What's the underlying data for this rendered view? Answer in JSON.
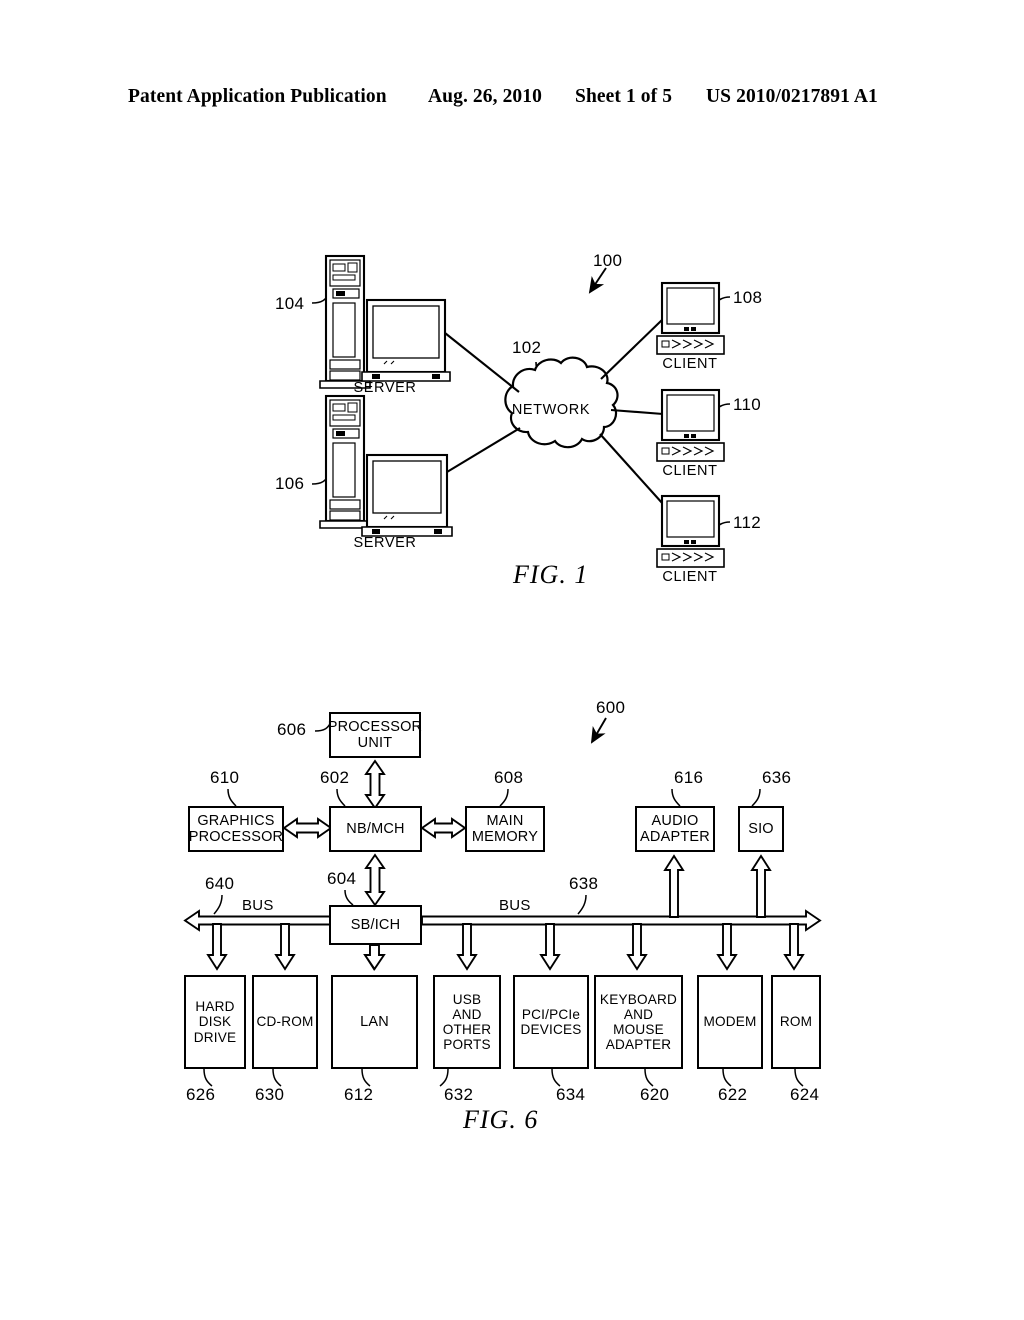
{
  "header": {
    "publication": "Patent Application Publication",
    "date": "Aug. 26, 2010",
    "sheet": "Sheet 1 of 5",
    "patent_number": "US 2010/0217891 A1"
  },
  "figure1": {
    "caption": "FIG. 1",
    "system_ref": "100",
    "network": {
      "label": "NETWORK",
      "ref": "102"
    },
    "servers": [
      {
        "label": "SERVER",
        "ref": "104"
      },
      {
        "label": "SERVER",
        "ref": "106"
      }
    ],
    "clients": [
      {
        "label": "CLIENT",
        "ref": "108"
      },
      {
        "label": "CLIENT",
        "ref": "110"
      },
      {
        "label": "CLIENT",
        "ref": "112"
      }
    ]
  },
  "figure6": {
    "caption": "FIG. 6",
    "system_ref": "600",
    "bus_label_left": "BUS",
    "bus_label_right": "BUS",
    "bus_ref_left": "640",
    "bus_ref_right": "638",
    "blocks": [
      {
        "id": "processor-unit",
        "label": "PROCESSOR\nUNIT",
        "ref": "606"
      },
      {
        "id": "graphics-processor",
        "label": "GRAPHICS\nPROCESSOR",
        "ref": "610"
      },
      {
        "id": "nb-mch",
        "label": "NB/MCH",
        "ref": "602"
      },
      {
        "id": "main-memory",
        "label": "MAIN\nMEMORY",
        "ref": "608"
      },
      {
        "id": "audio-adapter",
        "label": "AUDIO\nADAPTER",
        "ref": "616"
      },
      {
        "id": "sio",
        "label": "SIO",
        "ref": "636"
      },
      {
        "id": "sb-ich",
        "label": "SB/ICH",
        "ref": "604"
      },
      {
        "id": "hard-disk-drive",
        "label": "HARD\nDISK\nDRIVE",
        "ref": "626"
      },
      {
        "id": "cd-rom",
        "label": "CD-ROM",
        "ref": "630"
      },
      {
        "id": "lan",
        "label": "LAN",
        "ref": "612"
      },
      {
        "id": "usb-other-ports",
        "label": "USB AND\nOTHER\nPORTS",
        "ref": "632"
      },
      {
        "id": "pci-pcie-devices",
        "label": "PCI/PCIe\nDEVICES",
        "ref": "634"
      },
      {
        "id": "keyboard-mouse-adapter",
        "label": "KEYBOARD\nAND\nMOUSE\nADAPTER",
        "ref": "620"
      },
      {
        "id": "modem",
        "label": "MODEM",
        "ref": "622"
      },
      {
        "id": "rom",
        "label": "ROM",
        "ref": "624"
      }
    ]
  }
}
